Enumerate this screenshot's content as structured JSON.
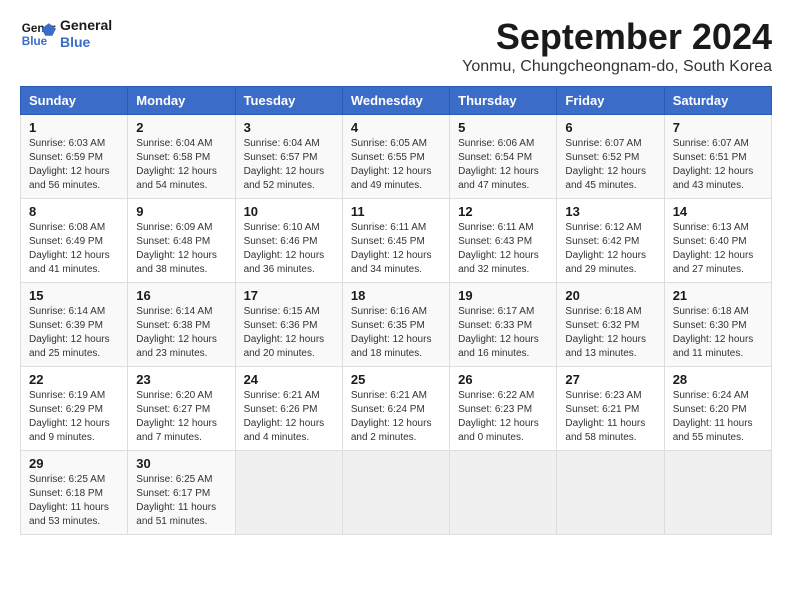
{
  "header": {
    "logo_line1": "General",
    "logo_line2": "Blue",
    "title": "September 2024",
    "subtitle": "Yonmu, Chungcheongnam-do, South Korea"
  },
  "calendar": {
    "headers": [
      "Sunday",
      "Monday",
      "Tuesday",
      "Wednesday",
      "Thursday",
      "Friday",
      "Saturday"
    ],
    "weeks": [
      [
        {
          "day": "",
          "info": ""
        },
        {
          "day": "2",
          "info": "Sunrise: 6:04 AM\nSunset: 6:58 PM\nDaylight: 12 hours\nand 54 minutes."
        },
        {
          "day": "3",
          "info": "Sunrise: 6:04 AM\nSunset: 6:57 PM\nDaylight: 12 hours\nand 52 minutes."
        },
        {
          "day": "4",
          "info": "Sunrise: 6:05 AM\nSunset: 6:55 PM\nDaylight: 12 hours\nand 49 minutes."
        },
        {
          "day": "5",
          "info": "Sunrise: 6:06 AM\nSunset: 6:54 PM\nDaylight: 12 hours\nand 47 minutes."
        },
        {
          "day": "6",
          "info": "Sunrise: 6:07 AM\nSunset: 6:52 PM\nDaylight: 12 hours\nand 45 minutes."
        },
        {
          "day": "7",
          "info": "Sunrise: 6:07 AM\nSunset: 6:51 PM\nDaylight: 12 hours\nand 43 minutes."
        }
      ],
      [
        {
          "day": "1",
          "info": "Sunrise: 6:03 AM\nSunset: 6:59 PM\nDaylight: 12 hours\nand 56 minutes."
        },
        {
          "day": "9",
          "info": "Sunrise: 6:09 AM\nSunset: 6:48 PM\nDaylight: 12 hours\nand 38 minutes."
        },
        {
          "day": "10",
          "info": "Sunrise: 6:10 AM\nSunset: 6:46 PM\nDaylight: 12 hours\nand 36 minutes."
        },
        {
          "day": "11",
          "info": "Sunrise: 6:11 AM\nSunset: 6:45 PM\nDaylight: 12 hours\nand 34 minutes."
        },
        {
          "day": "12",
          "info": "Sunrise: 6:11 AM\nSunset: 6:43 PM\nDaylight: 12 hours\nand 32 minutes."
        },
        {
          "day": "13",
          "info": "Sunrise: 6:12 AM\nSunset: 6:42 PM\nDaylight: 12 hours\nand 29 minutes."
        },
        {
          "day": "14",
          "info": "Sunrise: 6:13 AM\nSunset: 6:40 PM\nDaylight: 12 hours\nand 27 minutes."
        }
      ],
      [
        {
          "day": "8",
          "info": "Sunrise: 6:08 AM\nSunset: 6:49 PM\nDaylight: 12 hours\nand 41 minutes."
        },
        {
          "day": "16",
          "info": "Sunrise: 6:14 AM\nSunset: 6:38 PM\nDaylight: 12 hours\nand 23 minutes."
        },
        {
          "day": "17",
          "info": "Sunrise: 6:15 AM\nSunset: 6:36 PM\nDaylight: 12 hours\nand 20 minutes."
        },
        {
          "day": "18",
          "info": "Sunrise: 6:16 AM\nSunset: 6:35 PM\nDaylight: 12 hours\nand 18 minutes."
        },
        {
          "day": "19",
          "info": "Sunrise: 6:17 AM\nSunset: 6:33 PM\nDaylight: 12 hours\nand 16 minutes."
        },
        {
          "day": "20",
          "info": "Sunrise: 6:18 AM\nSunset: 6:32 PM\nDaylight: 12 hours\nand 13 minutes."
        },
        {
          "day": "21",
          "info": "Sunrise: 6:18 AM\nSunset: 6:30 PM\nDaylight: 12 hours\nand 11 minutes."
        }
      ],
      [
        {
          "day": "15",
          "info": "Sunrise: 6:14 AM\nSunset: 6:39 PM\nDaylight: 12 hours\nand 25 minutes."
        },
        {
          "day": "23",
          "info": "Sunrise: 6:20 AM\nSunset: 6:27 PM\nDaylight: 12 hours\nand 7 minutes."
        },
        {
          "day": "24",
          "info": "Sunrise: 6:21 AM\nSunset: 6:26 PM\nDaylight: 12 hours\nand 4 minutes."
        },
        {
          "day": "25",
          "info": "Sunrise: 6:21 AM\nSunset: 6:24 PM\nDaylight: 12 hours\nand 2 minutes."
        },
        {
          "day": "26",
          "info": "Sunrise: 6:22 AM\nSunset: 6:23 PM\nDaylight: 12 hours\nand 0 minutes."
        },
        {
          "day": "27",
          "info": "Sunrise: 6:23 AM\nSunset: 6:21 PM\nDaylight: 11 hours\nand 58 minutes."
        },
        {
          "day": "28",
          "info": "Sunrise: 6:24 AM\nSunset: 6:20 PM\nDaylight: 11 hours\nand 55 minutes."
        }
      ],
      [
        {
          "day": "22",
          "info": "Sunrise: 6:19 AM\nSunset: 6:29 PM\nDaylight: 12 hours\nand 9 minutes."
        },
        {
          "day": "30",
          "info": "Sunrise: 6:25 AM\nSunset: 6:17 PM\nDaylight: 11 hours\nand 51 minutes."
        },
        {
          "day": "",
          "info": ""
        },
        {
          "day": "",
          "info": ""
        },
        {
          "day": "",
          "info": ""
        },
        {
          "day": "",
          "info": ""
        },
        {
          "day": ""
        }
      ],
      [
        {
          "day": "29",
          "info": "Sunrise: 6:25 AM\nSunset: 6:18 PM\nDaylight: 11 hours\nand 53 minutes."
        },
        {
          "day": "",
          "info": ""
        },
        {
          "day": "",
          "info": ""
        },
        {
          "day": "",
          "info": ""
        },
        {
          "day": "",
          "info": ""
        },
        {
          "day": "",
          "info": ""
        },
        {
          "day": "",
          "info": ""
        }
      ]
    ]
  }
}
